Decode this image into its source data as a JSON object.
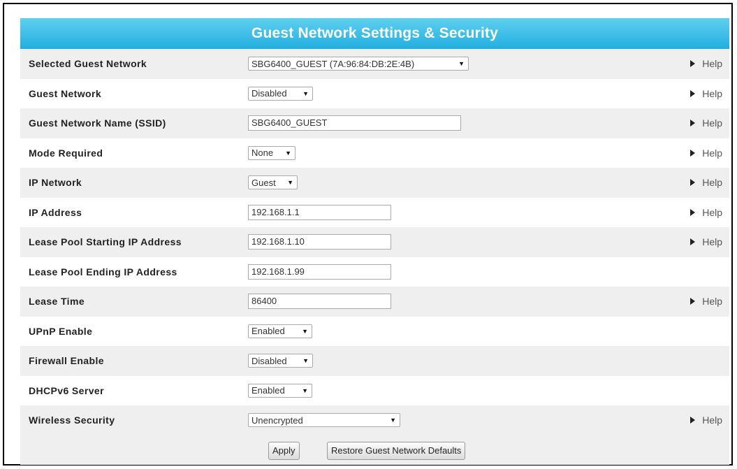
{
  "title": "Guest Network Settings & Security",
  "help_label": "Help",
  "rows": [
    {
      "label": "Selected Guest Network",
      "value": "SBG6400_GUEST (7A:96:84:DB:2E:4B)",
      "kind": "select"
    },
    {
      "label": "Guest Network",
      "value": "Disabled",
      "kind": "select"
    },
    {
      "label": "Guest Network Name (SSID)",
      "value": "SBG6400_GUEST",
      "kind": "text"
    },
    {
      "label": "Mode Required",
      "value": "None",
      "kind": "select"
    },
    {
      "label": "IP Network",
      "value": "Guest",
      "kind": "select"
    },
    {
      "label": "IP Address",
      "value": "192.168.1.1",
      "kind": "text"
    },
    {
      "label": "Lease Pool Starting IP Address",
      "value": "192.168.1.10",
      "kind": "text"
    },
    {
      "label": "Lease Pool Ending IP Address",
      "value": "192.168.1.99",
      "kind": "text"
    },
    {
      "label": "Lease Time",
      "value": "86400",
      "kind": "text"
    },
    {
      "label": "UPnP Enable",
      "value": "Enabled",
      "kind": "select"
    },
    {
      "label": "Firewall Enable",
      "value": "Disabled",
      "kind": "select"
    },
    {
      "label": "DHCPv6 Server",
      "value": "Enabled",
      "kind": "select"
    },
    {
      "label": "Wireless Security",
      "value": "Unencrypted",
      "kind": "select"
    }
  ],
  "buttons": {
    "apply": "Apply",
    "restore": "Restore Guest Network Defaults"
  }
}
